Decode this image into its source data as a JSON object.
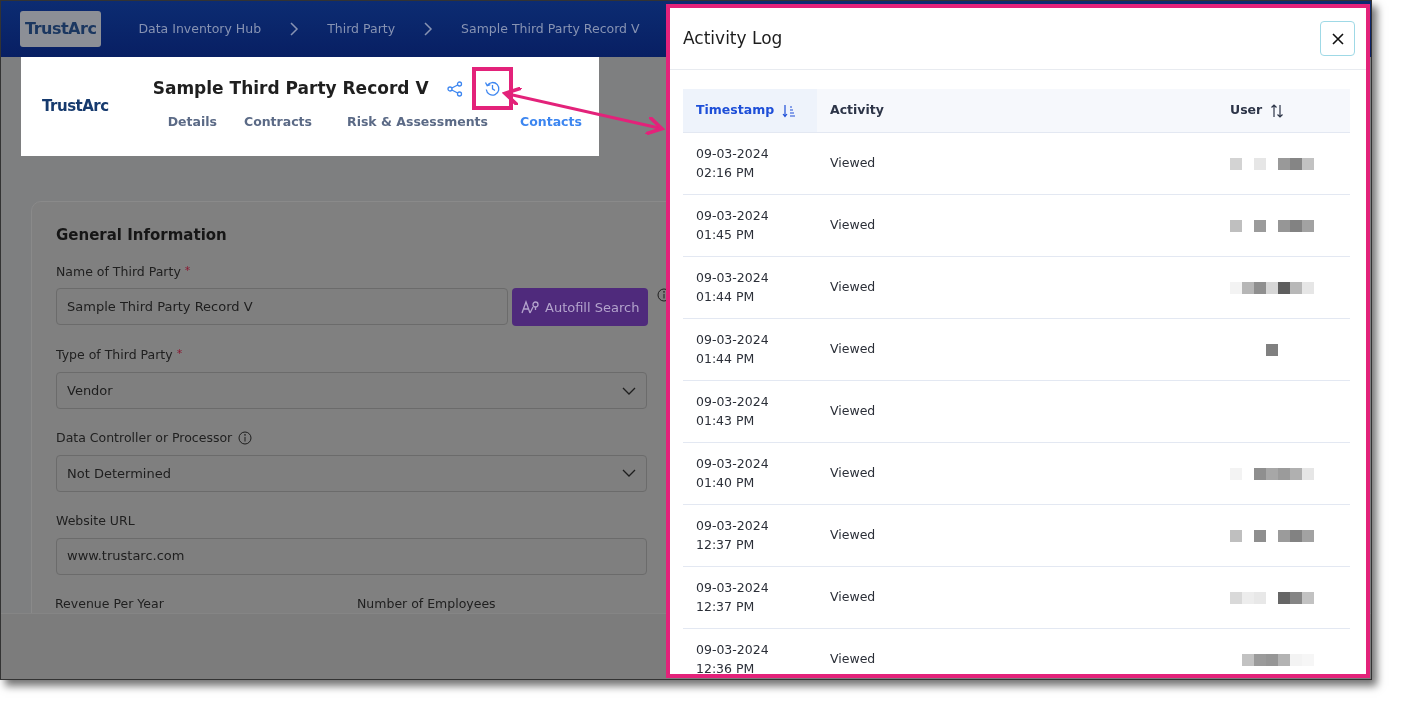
{
  "navbar": {
    "logo": "TrustArc",
    "breadcrumbs": [
      "Data Inventory Hub",
      "Third Party",
      "Sample Third Party Record V"
    ]
  },
  "record": {
    "logo": "TrustArc",
    "title": "Sample Third Party Record V",
    "tabs": [
      {
        "label": "Details",
        "selected": false
      },
      {
        "label": "Contracts",
        "selected": false
      },
      {
        "label": "Risk & Assessments",
        "selected": false
      },
      {
        "label": "Contacts",
        "selected": true
      }
    ]
  },
  "form": {
    "title": "General Information",
    "fields": [
      {
        "kind": "text",
        "label": "Name of Third Party",
        "required_marker": "*",
        "info": true,
        "value": "Sample Third Party Record V",
        "button": "Autofill Search"
      },
      {
        "kind": "select",
        "label": "Type of Third Party",
        "required_marker": "*",
        "info": false,
        "value": "Vendor"
      },
      {
        "kind": "select",
        "label": "Data Controller or Processor",
        "info": true,
        "value": "Not Determined"
      },
      {
        "kind": "text",
        "label": "Website URL",
        "info": false,
        "value": "www.trustarc.com"
      }
    ],
    "more_labels": [
      "Revenue Per Year",
      "Number of Employees"
    ]
  },
  "modal": {
    "title": "Activity Log",
    "columns": [
      {
        "label": "Timestamp",
        "sortable": true,
        "selected": true
      },
      {
        "label": "Activity",
        "sortable": false,
        "selected": false
      },
      {
        "label": "User",
        "sortable": true,
        "selected": false
      }
    ],
    "rows": [
      {
        "timestamp": "09-03-2024 02:16 PM",
        "activity": "Viewed"
      },
      {
        "timestamp": "09-03-2024 01:45 PM",
        "activity": "Viewed"
      },
      {
        "timestamp": "09-03-2024 01:44 PM",
        "activity": "Viewed"
      },
      {
        "timestamp": "09-03-2024 01:44 PM",
        "activity": "Viewed"
      },
      {
        "timestamp": "09-03-2024 01:43 PM",
        "activity": "Viewed"
      },
      {
        "timestamp": "09-03-2024 01:40 PM",
        "activity": "Viewed"
      },
      {
        "timestamp": "09-03-2024 12:37 PM",
        "activity": "Viewed"
      },
      {
        "timestamp": "09-03-2024 12:37 PM",
        "activity": "Viewed"
      },
      {
        "timestamp": "09-03-2024 12:36 PM",
        "activity": "Viewed"
      }
    ]
  }
}
